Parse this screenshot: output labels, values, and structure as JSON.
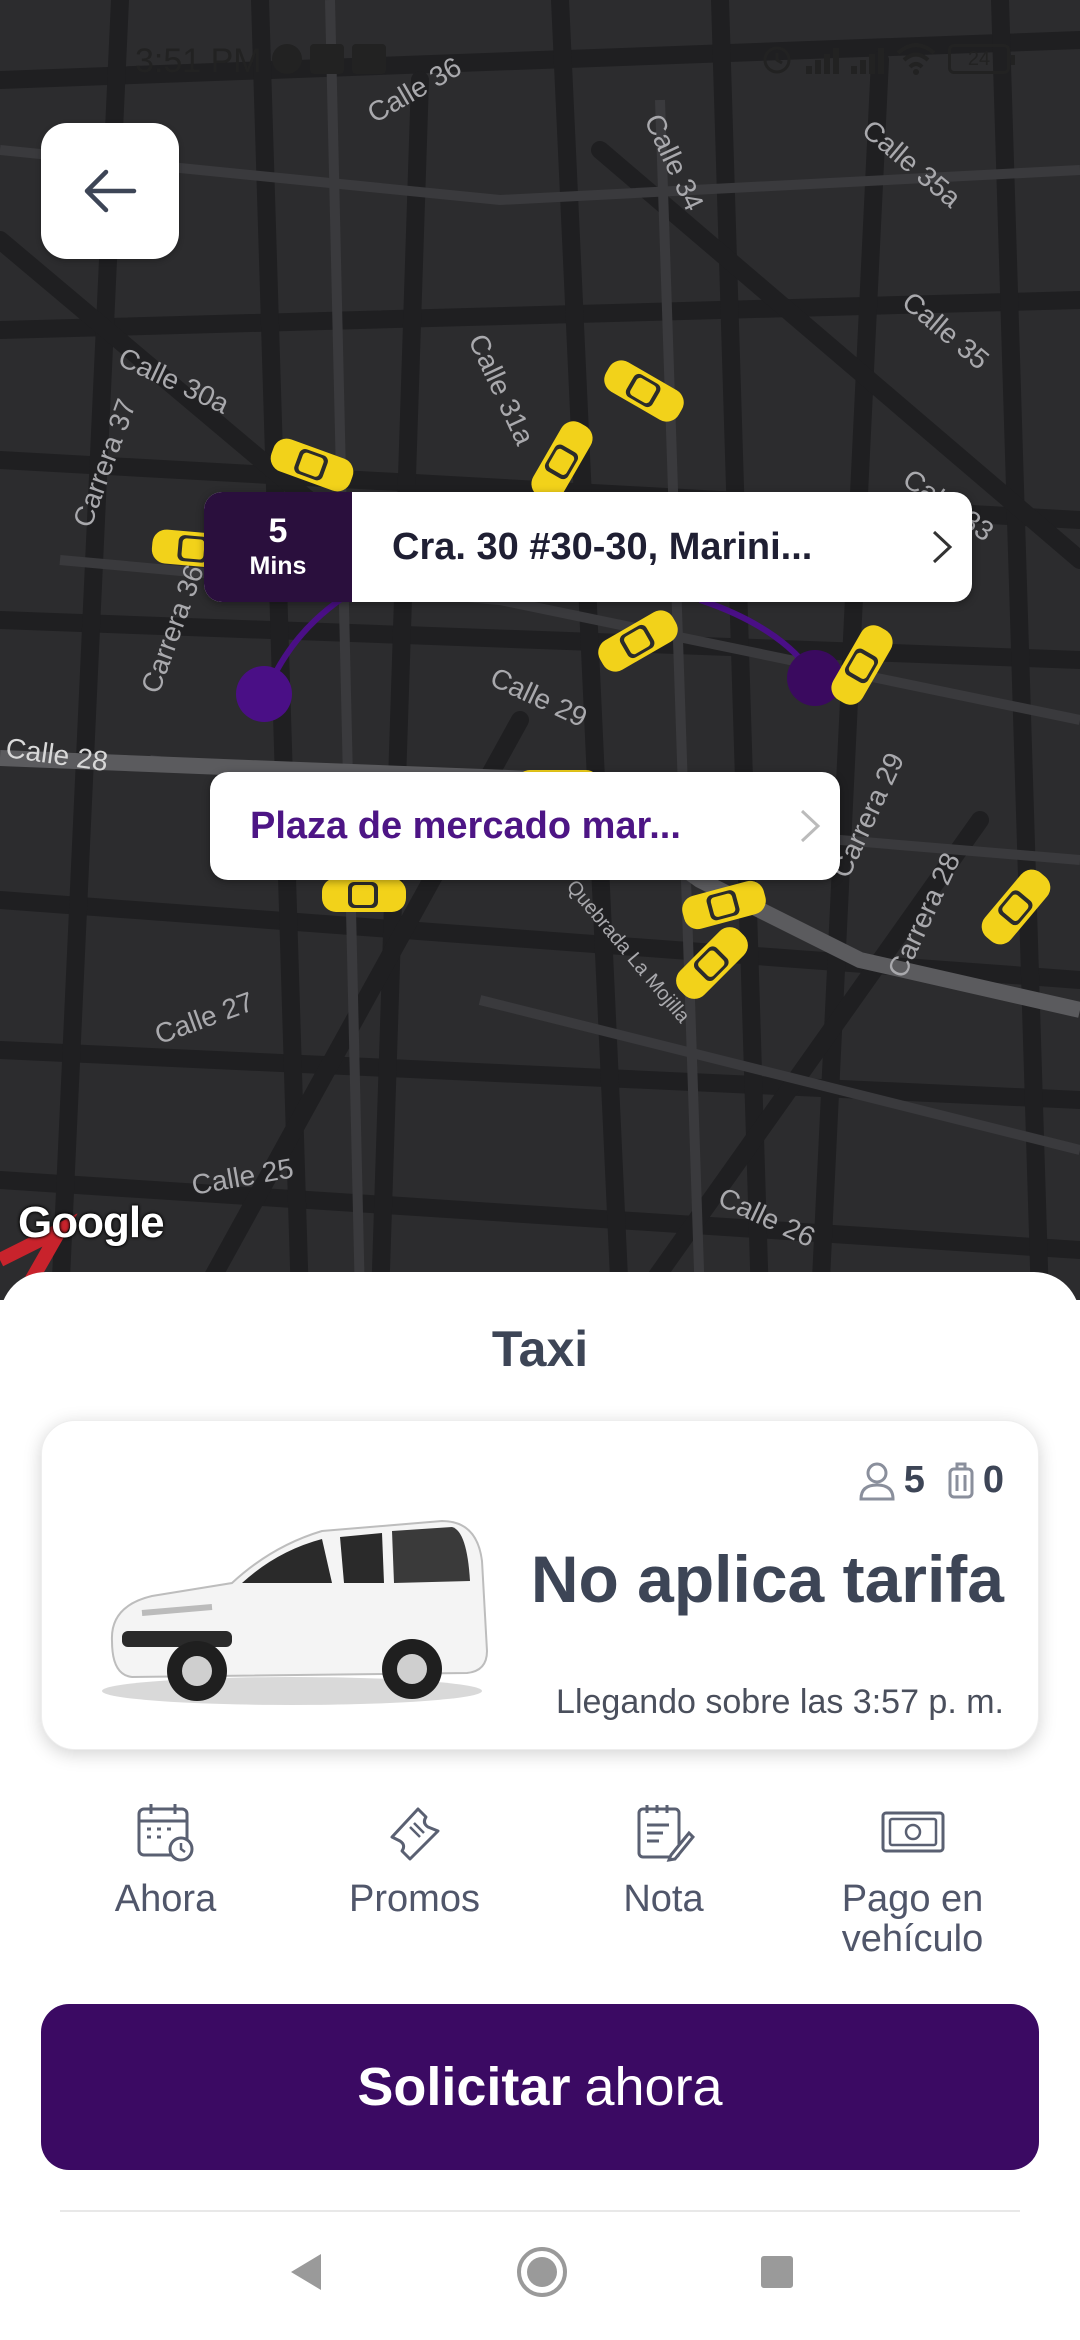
{
  "status_bar": {
    "time": "3:51 PM",
    "battery": "24"
  },
  "map": {
    "streets": [
      "Calle 36",
      "Calle 34",
      "Calle 35a",
      "Calle 35",
      "Calle 30a",
      "Calle 31a",
      "Carrera 37",
      "Carrera 36",
      "Calle 33",
      "Calle 29",
      "Calle 28",
      "Carrera 29",
      "Carrera 28",
      "Quebrada La Mojilla",
      "Calle 27",
      "Calle 25",
      "Calle 26"
    ],
    "provider": "Google",
    "route_color": "#4a0f86"
  },
  "back_button": {
    "icon": "arrow-left-icon"
  },
  "destination": {
    "eta_value": "5",
    "eta_unit": "Mins",
    "address": "Cra. 30 #30-30, Marini..."
  },
  "origin": {
    "address": "Plaza de mercado mar..."
  },
  "sheet": {
    "title": "Taxi",
    "vehicle": {
      "passengers": "5",
      "luggage": "0",
      "fare": "No aplica tarifa",
      "arrival": "Llegando sobre las 3:57 p. m."
    },
    "options": [
      {
        "label": "Ahora",
        "icon": "calendar-clock-icon"
      },
      {
        "label": "Promos",
        "icon": "ticket-icon"
      },
      {
        "label": "Nota",
        "icon": "note-edit-icon"
      },
      {
        "label": "Pago en vehículo",
        "icon": "cash-icon"
      }
    ],
    "request": {
      "bold": "Solicitar",
      "light": "ahora"
    }
  },
  "colors": {
    "primary": "#3b0a63",
    "accent_text": "#4d1585",
    "map_bg": "#2c2c2e",
    "taxi": "#f2d21a"
  }
}
